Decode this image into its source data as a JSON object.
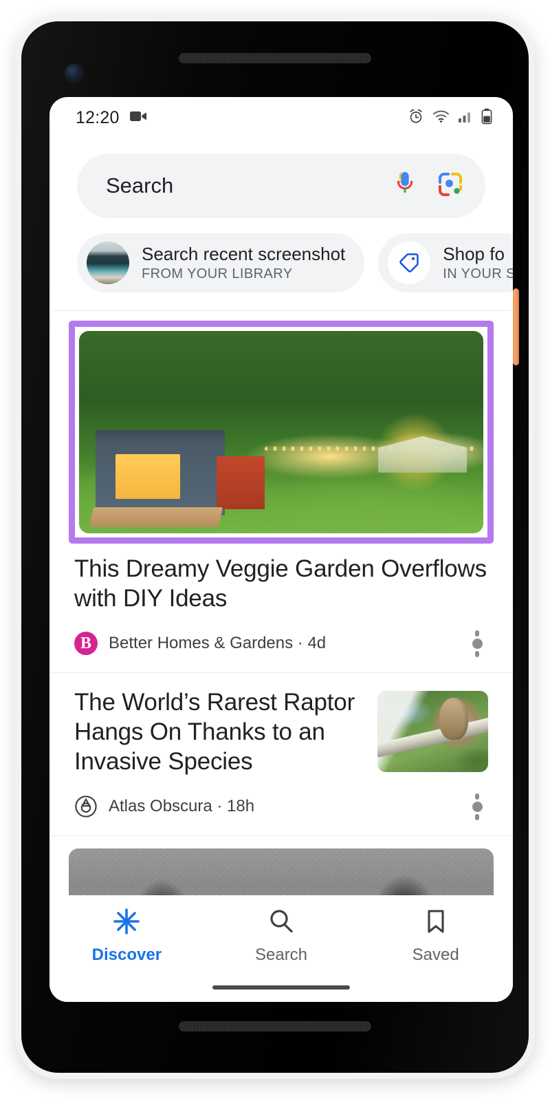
{
  "device": {
    "name": "android-phone",
    "side_button": "power-button"
  },
  "status_bar": {
    "time": "12:20",
    "icons": [
      "video-camera-icon",
      "alarm-clock-icon",
      "wifi-icon",
      "cellular-signal-icon",
      "battery-icon"
    ]
  },
  "search": {
    "placeholder": "Search",
    "voice_icon": "microphone-icon",
    "lens_icon": "google-lens-camera-icon"
  },
  "chips": [
    {
      "title": "Search recent screenshot",
      "subtitle": "FROM YOUR LIBRARY",
      "icon": "screenshot-thumbnail"
    },
    {
      "title": "Shop fo",
      "subtitle": "IN YOUR S",
      "icon": "price-tag-icon"
    }
  ],
  "feed": {
    "highlight_color": "#b47aee",
    "cards": [
      {
        "title": "This Dreamy Veggie Garden Overflows with DIY Ideas",
        "source": "Better Homes & Gardens",
        "time": "4d",
        "source_meta": "Better Homes & Gardens · 4d",
        "avatar_letter": "B",
        "avatar_color": "#d4248f",
        "image": "garden-with-shed-and-string-lights",
        "overflow_icon": "more-options-icon",
        "highlighted": true
      },
      {
        "title": "The World’s Rarest Raptor Hangs On Thanks to an Invasive Species",
        "source": "Atlas Obscura",
        "time": "18h",
        "source_meta": "Atlas Obscura · 18h",
        "avatar_letter": "",
        "avatar_color": "#3c4043",
        "image": "raptor-perched-on-branch",
        "overflow_icon": "more-options-icon",
        "highlighted": false
      },
      {
        "title": "",
        "source": "",
        "time": "",
        "source_meta": "",
        "image": "black-and-white-photo-partially-visible",
        "highlighted": false
      }
    ]
  },
  "bottom_nav": {
    "active": "Discover",
    "active_color": "#1a73e8",
    "items": [
      {
        "label": "Discover",
        "icon": "discover-sparkle-icon"
      },
      {
        "label": "Search",
        "icon": "search-magnifier-icon"
      },
      {
        "label": "Saved",
        "icon": "bookmark-icon"
      }
    ]
  }
}
